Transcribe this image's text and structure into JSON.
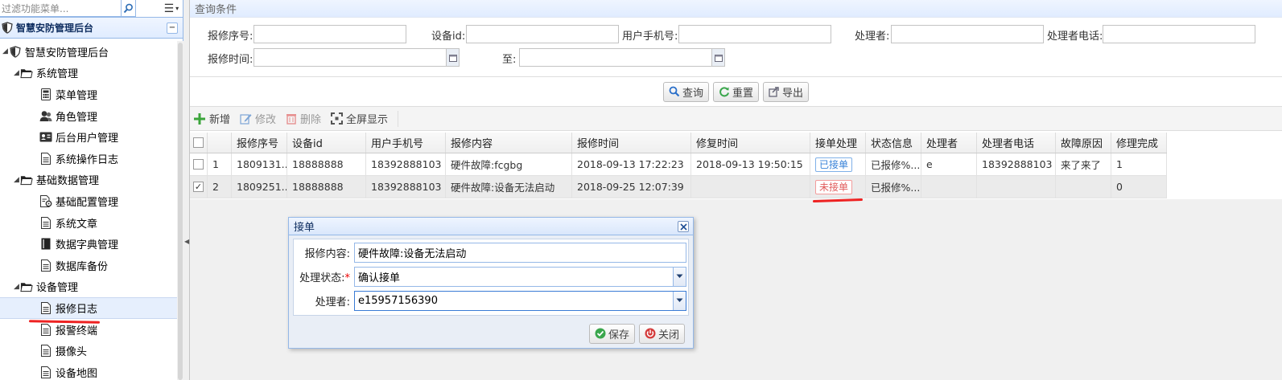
{
  "sidebar": {
    "filter_placeholder": "过滤功能菜单...",
    "panel_title": "智慧安防管理后台",
    "tree": [
      {
        "label": "智慧安防管理后台",
        "level": 0,
        "icon": "shield-icon",
        "expanded": true
      },
      {
        "label": "系统管理",
        "level": 1,
        "icon": "folder-icon",
        "expanded": true
      },
      {
        "label": "菜单管理",
        "level": 2,
        "icon": "calculator-icon"
      },
      {
        "label": "角色管理",
        "level": 2,
        "icon": "users-icon"
      },
      {
        "label": "后台用户管理",
        "level": 2,
        "icon": "id-card-icon"
      },
      {
        "label": "系统操作日志",
        "level": 2,
        "icon": "document-icon"
      },
      {
        "label": "基础数据管理",
        "level": 1,
        "icon": "folder-icon",
        "expanded": true
      },
      {
        "label": "基础配置管理",
        "level": 2,
        "icon": "config-icon"
      },
      {
        "label": "系统文章",
        "level": 2,
        "icon": "document-icon"
      },
      {
        "label": "数据字典管理",
        "level": 2,
        "icon": "book-icon"
      },
      {
        "label": "数据库备份",
        "level": 2,
        "icon": "document-icon"
      },
      {
        "label": "设备管理",
        "level": 1,
        "icon": "folder-icon",
        "expanded": true
      },
      {
        "label": "报修日志",
        "level": 2,
        "icon": "document-icon",
        "selected": true
      },
      {
        "label": "报警终端",
        "level": 2,
        "icon": "document-icon"
      },
      {
        "label": "摄像头",
        "level": 2,
        "icon": "document-icon"
      },
      {
        "label": "设备地图",
        "level": 2,
        "icon": "document-icon"
      }
    ]
  },
  "query": {
    "title": "查询条件",
    "fields": {
      "repair_no": "报修序号:",
      "device_id": "设备id:",
      "user_phone": "用户手机号:",
      "handler": "处理者:",
      "handler_phone": "处理者电话:",
      "repair_time": "报修时间:",
      "to": "至:"
    },
    "buttons": {
      "search": "查询",
      "reset": "重置",
      "export": "导出"
    }
  },
  "toolbar": {
    "add": "新增",
    "edit": "修改",
    "delete": "删除",
    "fullscreen": "全屏显示"
  },
  "grid": {
    "columns": [
      "",
      "",
      "报修序号",
      "设备id",
      "用户手机号",
      "报修内容",
      "报修时间",
      "修复时间",
      "接单处理",
      "状态信息",
      "处理者",
      "处理者电话",
      "故障原因",
      "修理完成"
    ],
    "rows": [
      {
        "checked": false,
        "index": "1",
        "repair_no": "1809131...",
        "device_id": "18888888",
        "user_phone": "18392888103",
        "content": "硬件故障:fcgbg",
        "repair_time": "2018-09-13 17:22:23",
        "fixed_time": "2018-09-13 19:50:15",
        "accept": "已接单",
        "status": "已报修%...",
        "handler": "e",
        "handler_phone": "18392888103",
        "cause": "来了来了",
        "done": "1"
      },
      {
        "checked": true,
        "index": "2",
        "repair_no": "1809251...",
        "device_id": "18888888",
        "user_phone": "18392888103",
        "content": "硬件故障:设备无法启动",
        "repair_time": "2018-09-25 12:07:39",
        "fixed_time": "",
        "accept": "未接单",
        "status": "已报修%...",
        "handler": "",
        "handler_phone": "",
        "cause": "",
        "done": "0"
      }
    ]
  },
  "dialog": {
    "title": "接单",
    "content_label": "报修内容:",
    "content_value": "硬件故障:设备无法启动",
    "status_label": "处理状态:",
    "status_required": "*",
    "status_value": "确认接单",
    "handler_label": "处理者:",
    "handler_value": "e15957156390",
    "save": "保存",
    "close": "关闭"
  },
  "colors": {
    "accent_border": "#95b8e7",
    "badge_blue": "#3a83d8",
    "badge_red": "#e05a5a",
    "annotation_red": "#e22"
  }
}
